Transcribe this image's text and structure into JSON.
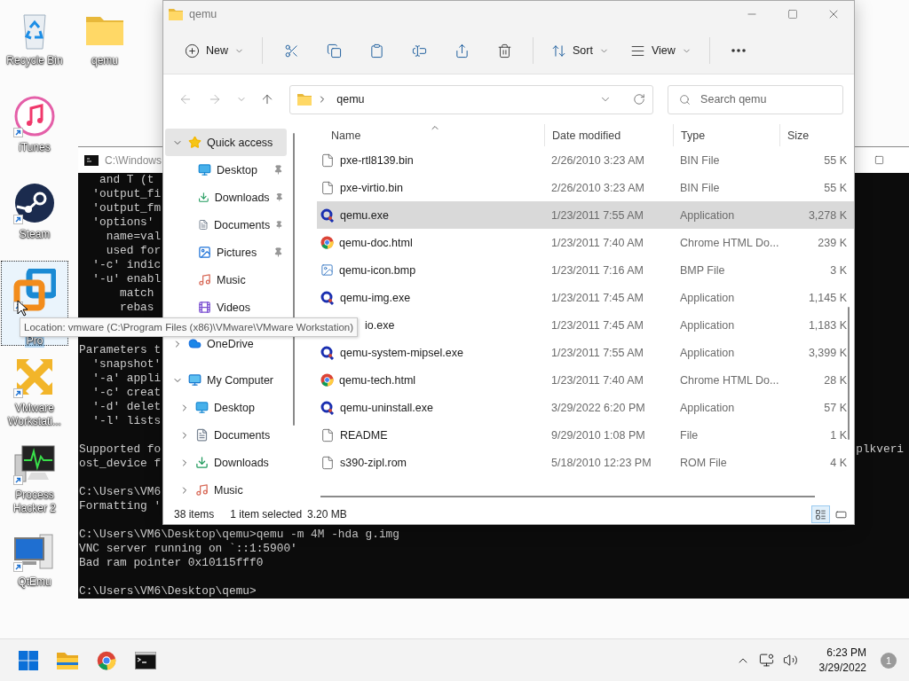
{
  "desktop": {
    "icons": [
      {
        "label": "Recycle Bin",
        "kind": "recycle",
        "shortcut": false,
        "selected": false
      },
      {
        "label": "qemu",
        "kind": "folder",
        "shortcut": false,
        "selected": false
      },
      {
        "label": "iTunes",
        "kind": "itunes",
        "shortcut": true,
        "selected": false
      },
      {
        "label": "Steam",
        "kind": "steam",
        "shortcut": true,
        "selected": false
      },
      {
        "label": "Pro",
        "kind": "vmware-pro",
        "shortcut": true,
        "selected": true
      },
      {
        "label": "VMware Workstati...",
        "kind": "vmware",
        "shortcut": true,
        "selected": false
      },
      {
        "label": "Process Hacker 2",
        "kind": "hacker",
        "shortcut": true,
        "selected": false
      },
      {
        "label": "QtEmu",
        "kind": "qtemu",
        "shortcut": true,
        "selected": false
      }
    ]
  },
  "terminal": {
    "title": "C:\\Windows",
    "blocks": [
      [
        "   and T (t",
        "  'output_fi",
        "  'output_fm",
        "  'options'",
        "    name=val",
        "    used for",
        "  '-c' indic",
        "  '-u' enabl",
        "      match",
        "      rebas"
      ],
      [
        "Parameters t",
        "  'snapshot'",
        "  '-a' appli",
        "  '-c' creat",
        "  '-d' delet",
        "  '-l' lists"
      ],
      [
        {
          "text": "Supported fo",
          "tail": "plkveri"
        },
        "ost_device f"
      ],
      [
        "C:\\Users\\VM6",
        "Formatting '"
      ],
      [
        "C:\\Users\\VM6\\Desktop\\qemu>qemu -m 4M -hda g.img",
        "VNC server running on `::1:5900'",
        "Bad ram pointer 0x10115fff0"
      ],
      [
        "C:\\Users\\VM6\\Desktop\\qemu>"
      ]
    ]
  },
  "explorer": {
    "title": "qemu",
    "toolbar": [
      {
        "kind": "new",
        "label": "New"
      },
      {
        "kind": "cut"
      },
      {
        "kind": "copy"
      },
      {
        "kind": "paste"
      },
      {
        "kind": "rename"
      },
      {
        "kind": "share"
      },
      {
        "kind": "delete"
      },
      {
        "kind": "sort",
        "label": "Sort"
      },
      {
        "kind": "view",
        "label": "View"
      },
      {
        "kind": "more"
      }
    ],
    "address": "qemu",
    "search": {
      "placeholder": "Search qemu"
    },
    "nav": [
      {
        "label": "Quick access",
        "kind": "star",
        "expanded": true,
        "selected": true,
        "children": [
          {
            "label": "Desktop",
            "kind": "desktop",
            "pinned": true
          },
          {
            "label": "Downloads",
            "kind": "downloads",
            "pinned": true
          },
          {
            "label": "Documents",
            "kind": "documents",
            "pinned": true
          },
          {
            "label": "Pictures",
            "kind": "pictures",
            "pinned": true
          },
          {
            "label": "Music",
            "kind": "music",
            "pinned": false
          },
          {
            "label": "Videos",
            "kind": "videos",
            "pinned": false
          }
        ]
      },
      {
        "label": "OneDrive",
        "kind": "cloud",
        "expanded": false,
        "selected": false
      },
      {
        "label": "My Computer",
        "kind": "computer",
        "expanded": true,
        "selected": false,
        "children": [
          {
            "label": "Desktop",
            "kind": "desktop",
            "expanded": false
          },
          {
            "label": "Documents",
            "kind": "documents",
            "expanded": false
          },
          {
            "label": "Downloads",
            "kind": "downloads",
            "expanded": false
          },
          {
            "label": "Music",
            "kind": "music",
            "expanded": false
          }
        ]
      }
    ],
    "columns": [
      "Name",
      "Date modified",
      "Type",
      "Size"
    ],
    "files": [
      {
        "name": "pxe-rtl8139.bin",
        "kind": "file",
        "date": "2/26/2010 3:23 AM",
        "type": "BIN File",
        "size": "55 K",
        "selected": false
      },
      {
        "name": "pxe-virtio.bin",
        "kind": "file",
        "date": "2/26/2010 3:23 AM",
        "type": "BIN File",
        "size": "55 K",
        "selected": false
      },
      {
        "name": "qemu.exe",
        "kind": "qemu",
        "date": "1/23/2011 7:55 AM",
        "type": "Application",
        "size": "3,278 K",
        "selected": true
      },
      {
        "name": "qemu-doc.html",
        "kind": "chrome",
        "date": "1/23/2011 7:40 AM",
        "type": "Chrome HTML Do...",
        "size": "239 K",
        "selected": false
      },
      {
        "name": "qemu-icon.bmp",
        "kind": "bmp",
        "date": "1/23/2011 7:16 AM",
        "type": "BMP File",
        "size": "3 K",
        "selected": false
      },
      {
        "name": "qemu-img.exe",
        "kind": "qemu",
        "date": "1/23/2011 7:45 AM",
        "type": "Application",
        "size": "1,145 K",
        "selected": false
      },
      {
        "name": "io.exe",
        "kind": "covered",
        "date": "1/23/2011 7:45 AM",
        "type": "Application",
        "size": "1,183 K",
        "selected": false
      },
      {
        "name": "qemu-system-mipsel.exe",
        "kind": "qemu",
        "date": "1/23/2011 7:55 AM",
        "type": "Application",
        "size": "3,399 K",
        "selected": false
      },
      {
        "name": "qemu-tech.html",
        "kind": "chrome",
        "date": "1/23/2011 7:40 AM",
        "type": "Chrome HTML Do...",
        "size": "28 K",
        "selected": false
      },
      {
        "name": "qemu-uninstall.exe",
        "kind": "qemu",
        "date": "3/29/2022 6:20 PM",
        "type": "Application",
        "size": "57 K",
        "selected": false
      },
      {
        "name": "README",
        "kind": "file",
        "date": "9/29/2010 1:08 PM",
        "type": "File",
        "size": "1 K",
        "selected": false
      },
      {
        "name": "s390-zipl.rom",
        "kind": "file",
        "date": "5/18/2010 12:23 PM",
        "type": "ROM File",
        "size": "4 K",
        "selected": false
      }
    ],
    "status": {
      "items": "38 items",
      "selection": "1 item selected",
      "size": "3.20 MB"
    },
    "views": [
      {
        "kind": "details",
        "selected": true
      },
      {
        "kind": "tiles",
        "selected": false
      }
    ]
  },
  "tooltip": "Location: vmware (C:\\Program Files (x86)\\VMware\\VMware Workstation)",
  "taskbar": {
    "apps": [
      {
        "kind": "start"
      },
      {
        "kind": "explorer"
      },
      {
        "kind": "chrome"
      },
      {
        "kind": "terminal"
      }
    ],
    "time": "6:23 PM",
    "date": "3/29/2022",
    "notifications": "1"
  }
}
